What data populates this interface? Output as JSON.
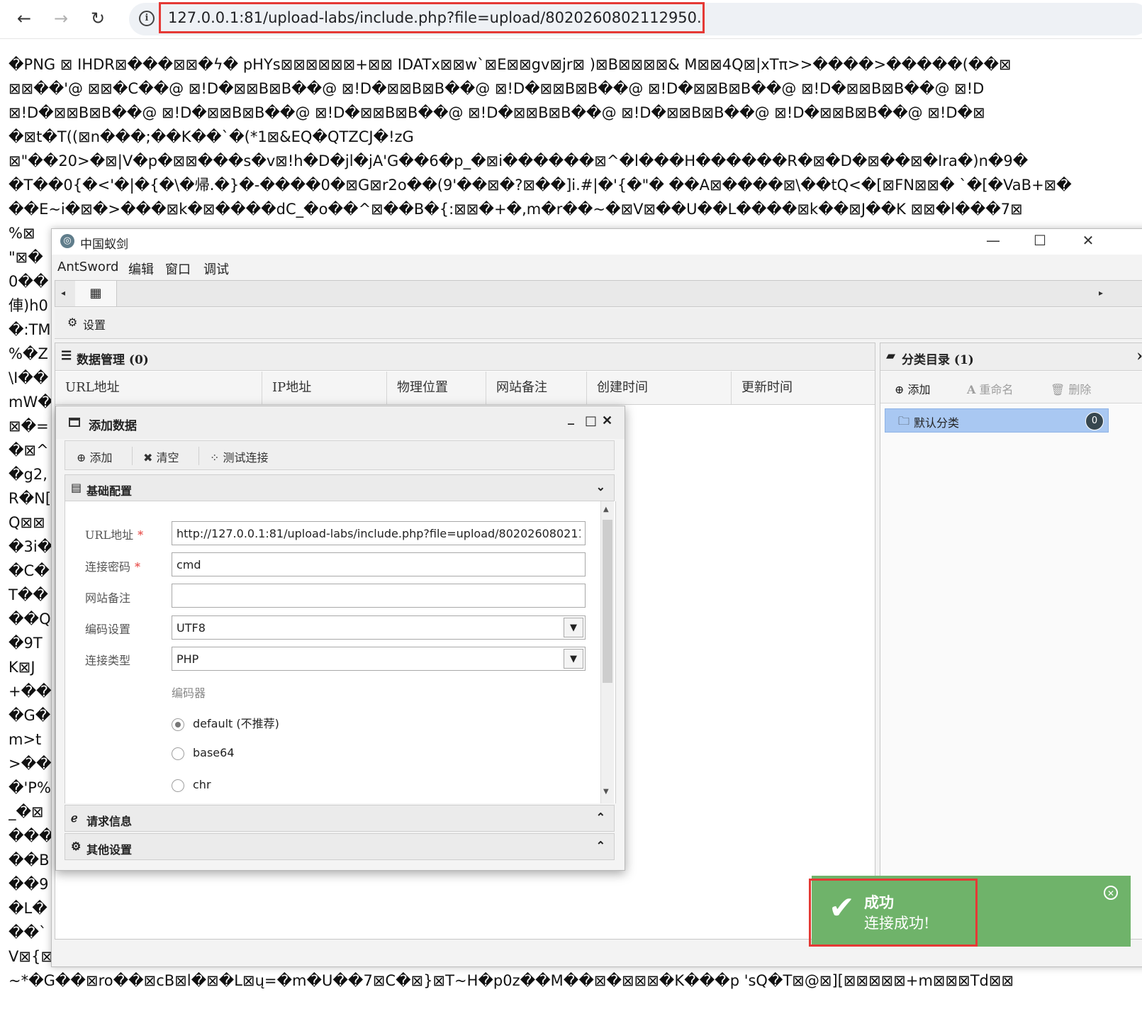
{
  "browser": {
    "url": "127.0.0.1:81/upload-labs/include.php?file=upload/8020260802112950.png",
    "back_icon": "←",
    "forward_icon": "→",
    "reload_icon": "↻",
    "info_icon": "i"
  },
  "garbled_lines": [
    "�PNG ⊠ IHDR⊠���⊠⊠�ϟ� pHYs⊠⊠⊠⊠⊠⊠+⊠⊠ IDATx⊠⊠w`⊠E⊠⊠gv⊠jr⊠ )⊠B⊠⊠⊠⊠& M⊠⊠4Q⊠|xTπ>>����>�����(��⊠",
    "⊠⊠��'@ ⊠⊠�C��@ ⊠!D�⊠⊠B⊠B��@ ⊠!D�⊠⊠B⊠B��@ ⊠!D�⊠⊠B⊠B��@ ⊠!D�⊠⊠B⊠B��@ ⊠!D�⊠⊠B⊠B��@ ⊠!D",
    "⊠!D�⊠⊠B⊠B��@ ⊠!D�⊠⊠B⊠B��@ ⊠!D�⊠⊠B⊠B��@ ⊠!D�⊠⊠B⊠B��@ ⊠!D�⊠⊠B⊠B��@ ⊠!D�⊠⊠B⊠B��@ ⊠!D�⊠",
    "�⊠t�T((⊠n���;��K��`�(*1⊠&EQ�QTZCJ�!zG",
    "⊠\"��20>�⊠|V�p�⊠⊠���s�v⊠!h�D�jl�jA'G��6�p_�⊠i������⊠^�l���H������R�⊠�D�⊠��⊠�Ira�)n�9�",
    "�T��0{�<'�|�{�\\�帰.�}�-����0�⊠G⊠r2o��(9'��⊠�?⊠��]i.#|�'{�\"� ��A⊠����⊠\\��tQ<�[⊠FN⊠⊠� `�[�VaB+⊠�",
    "��E~i�⊠�>���⊠k�⊠����dC_�o��^⊠��B�{:⊠⊠�+�,m�r��~�⊠V⊠��U��L����⊠k��⊠J��K ⊠⊠�l���7⊠",
    "%⊠",
    "\"⊠�",
    "0��",
    "俥)h0",
    "�:TM",
    "%�Z",
    "\\I��",
    "mW�",
    "⊠�=",
    "�⊠^",
    "�g2,",
    "R�N[",
    "Q⊠⊠",
    "�3i�",
    "�C�",
    "T��",
    "��Q",
    "�9T",
    "K⊠J",
    "+��",
    "�G�",
    "m>t",
    ">��",
    "�'P%",
    "_�⊠",
    "���",
    "��B",
    "��9",
    "�L�",
    "��`",
    "V⊠{⊠⊠j5ce⊠⊠⊠⊠**F=d⊠⊠⊠⊠lV⊠⊠⊠⊠^D⊠c@⊠⊠⊠⊠O⊠⊠⊠⊠f)⊠U⊠⊠⊠⊠⊠⊠⊠⊠⊠⊠O⊠=⊠⊠⊠o �⊠�� 0��w��V TZ2����",
    "~*�G��⊠ro��⊠cB⊠l�⊠�L⊠ų=�m�U��7⊠C�⊠}⊠T~H�p0z��M��⊠�⊠⊠⊠�K���p 'sQ�T⊠@⊠][⊠⊠⊠⊠⊠+m⊠⊠⊠Td⊠⊠"
  ],
  "app": {
    "title": "中国蚁剑",
    "logo_icon": "◎",
    "minimize_icon": "—",
    "maximize_icon": "☐",
    "close_icon": "✕",
    "menu": [
      "AntSword",
      "编辑",
      "窗口",
      "调试"
    ],
    "tab_left_icon": "◂",
    "tab_right_icon": "▸",
    "tab_grid_icon": "▦",
    "settings_label": "设置",
    "settings_icon": "⚙"
  },
  "data_panel": {
    "title": "数据管理 (0)",
    "icon": "☰",
    "columns": [
      "URL地址",
      "IP地址",
      "物理位置",
      "网站备注",
      "创建时间",
      "更新时间"
    ]
  },
  "category_panel": {
    "title": "分类目录 (1)",
    "icon": "▰",
    "chevron": "›",
    "add_label": "添加",
    "add_icon": "⊕",
    "rename_label": "重命名",
    "rename_icon": "A",
    "delete_label": "删除",
    "delete_icon": "🗑",
    "item_label": "默认分类",
    "item_icon": "🗀",
    "item_count": "0"
  },
  "dialog": {
    "title": "添加数据",
    "minimize_icon": "_",
    "maximize_icon": "□",
    "close_icon": "✕",
    "toolbar": {
      "add_label": "添加",
      "add_icon": "⊕",
      "clear_label": "清空",
      "clear_icon": "✖",
      "test_label": "测试连接",
      "test_icon": "⁘"
    },
    "basic_section": {
      "title": "基础配置",
      "icon": "▤",
      "chevron": "⌄"
    },
    "fields": {
      "url_label": "URL地址",
      "url_value": "http://127.0.0.1:81/upload-labs/include.php?file=upload/8020260802112950.png",
      "password_label": "连接密码",
      "password_value": "cmd",
      "note_label": "网站备注",
      "note_value": "",
      "encoding_label": "编码设置",
      "encoding_value": "UTF8",
      "type_label": "连接类型",
      "type_value": "PHP",
      "required_mark": "*",
      "dropdown_icon": "▼"
    },
    "encoder": {
      "label": "编码器",
      "options": [
        "default (不推荐)",
        "base64",
        "chr"
      ],
      "selected": "default (不推荐)"
    },
    "request_section": {
      "title": "请求信息",
      "icon": "ℯ",
      "chevron": "⌃"
    },
    "other_section": {
      "title": "其他设置",
      "icon": "⚙",
      "chevron": "⌃"
    },
    "scroll_up_icon": "▲",
    "scroll_down_icon": "▼"
  },
  "toast": {
    "title": "成功",
    "message": "连接成功!",
    "check_icon": "✔",
    "close_icon": "✕",
    "color": "#6fb36a"
  }
}
